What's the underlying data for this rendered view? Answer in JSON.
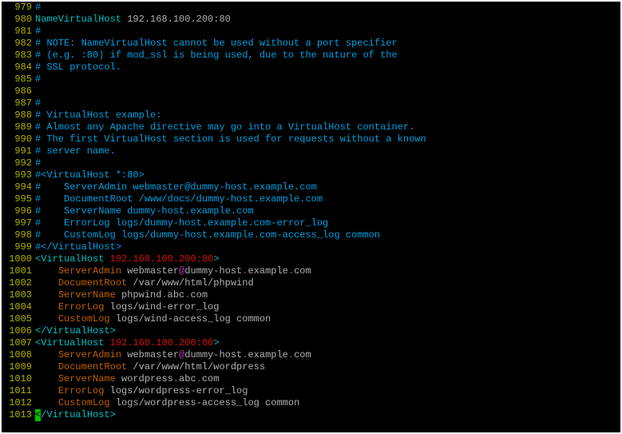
{
  "lines": [
    {
      "n": "979",
      "t": "cmt",
      "c": "#"
    },
    {
      "n": "980",
      "t": "nvh"
    },
    {
      "n": "981",
      "t": "cmt",
      "c": "#"
    },
    {
      "n": "982",
      "t": "cmt",
      "c": "# NOTE: NameVirtualHost cannot be used without a port specifier"
    },
    {
      "n": "983",
      "t": "cmt",
      "c": "# (e.g. :80) if mod_ssl is being used, due to the nature of the"
    },
    {
      "n": "984",
      "t": "cmt",
      "c": "# SSL protocol."
    },
    {
      "n": "985",
      "t": "cmt",
      "c": "#"
    },
    {
      "n": "986",
      "t": "cmt",
      "c": ""
    },
    {
      "n": "987",
      "t": "cmt",
      "c": "#"
    },
    {
      "n": "988",
      "t": "cmt",
      "c": "# VirtualHost example:"
    },
    {
      "n": "989",
      "t": "cmt",
      "c": "# Almost any Apache directive may go into a VirtualHost container."
    },
    {
      "n": "990",
      "t": "cmt",
      "c": "# The first VirtualHost section is used for requests without a known"
    },
    {
      "n": "991",
      "t": "cmt",
      "c": "# server name."
    },
    {
      "n": "992",
      "t": "cmt",
      "c": "#"
    },
    {
      "n": "993",
      "t": "cmt",
      "c": "#<VirtualHost *:80>"
    },
    {
      "n": "994",
      "t": "cmt",
      "c": "#    ServerAdmin webmaster@dummy-host.example.com"
    },
    {
      "n": "995",
      "t": "cmt",
      "c": "#    DocumentRoot /www/docs/dummy-host.example.com"
    },
    {
      "n": "996",
      "t": "cmt",
      "c": "#    ServerName dummy-host.example.com"
    },
    {
      "n": "997",
      "t": "cmt",
      "c": "#    ErrorLog logs/dummy-host.example.com-error_log"
    },
    {
      "n": "998",
      "t": "cmt",
      "c": "#    CustomLog logs/dummy-host.example.com-access_log common"
    },
    {
      "n": "999",
      "t": "cmt",
      "c": "#</VirtualHost>"
    },
    {
      "n": "1000",
      "t": "vhopen",
      "ip": "192.168.100.200:80"
    },
    {
      "n": "1001",
      "t": "sa",
      "email": [
        "webmaster",
        "@",
        "dummy-host",
        ".",
        "example",
        ".",
        "com"
      ]
    },
    {
      "n": "1002",
      "t": "dr",
      "path": "/var/www/html/phpwind"
    },
    {
      "n": "1003",
      "t": "sn",
      "host": [
        "phpwind",
        ".",
        "abc",
        ".",
        "com"
      ]
    },
    {
      "n": "1004",
      "t": "el",
      "path": "logs/wind-error_log"
    },
    {
      "n": "1005",
      "t": "cl",
      "path": "logs/wind-access_log",
      "arg": "common"
    },
    {
      "n": "1006",
      "t": "vhclose"
    },
    {
      "n": "1007",
      "t": "vhopen",
      "ip": "192.168.100.200:80"
    },
    {
      "n": "1008",
      "t": "sa",
      "email": [
        "webmaster",
        "@",
        "dummy-host",
        ".",
        "example",
        ".",
        "com"
      ]
    },
    {
      "n": "1009",
      "t": "dr",
      "path": "/var/www/html/wordpress"
    },
    {
      "n": "1010",
      "t": "sn",
      "host": [
        "wordpress",
        ".",
        "abc",
        ".",
        "com"
      ]
    },
    {
      "n": "1011",
      "t": "el",
      "path": "logs/wordpress-error_log"
    },
    {
      "n": "1012",
      "t": "cl",
      "path": "logs/wordpress-access_log",
      "arg": "common"
    },
    {
      "n": "1013",
      "t": "vhclose_cursor"
    }
  ],
  "tokens": {
    "NameVirtualHost": "NameVirtualHost",
    "nvh_ip": "192.168.100.200:80",
    "VirtualHost": "VirtualHost",
    "ServerAdmin": "ServerAdmin",
    "DocumentRoot": "DocumentRoot",
    "ServerName": "ServerName",
    "ErrorLog": "ErrorLog",
    "CustomLog": "CustomLog"
  }
}
